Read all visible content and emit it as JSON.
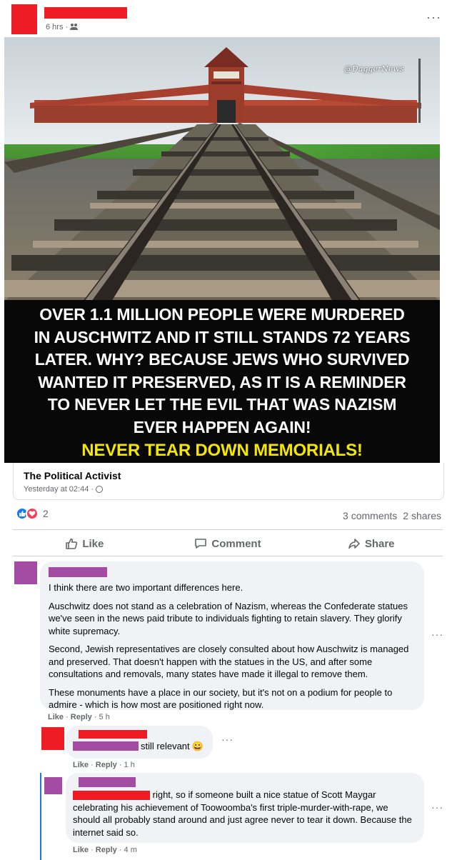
{
  "post": {
    "time": "6 hrs ·",
    "more": "···"
  },
  "image": {
    "watermark": "@DaggerNews",
    "caption_lines": [
      "OVER 1.1 MILLION PEOPLE WERE MURDERED",
      "IN AUSCHWITZ AND IT STILL STANDS 72 YEARS",
      "LATER. WHY? BECAUSE JEWS WHO SURVIVED",
      "WANTED IT PRESERVED, AS IT IS A REMINDER",
      "TO NEVER LET THE EVIL THAT WAS NAZISM",
      "EVER HAPPEN AGAIN!"
    ],
    "highlight": "NEVER TEAR DOWN MEMORIALS!"
  },
  "link": {
    "title": "The Political Activist",
    "time": "Yesterday at 02:44 ·"
  },
  "stats": {
    "reaction_count": "2",
    "comments": "3 comments",
    "shares": "2 shares"
  },
  "actions": {
    "like": "Like",
    "comment": "Comment",
    "share": "Share"
  },
  "comments": [
    {
      "paragraphs": [
        "I think there are two important differences here.",
        "Auschwitz does not stand as a celebration of Nazism, whereas the Confederate statues we've seen in the news paid tribute to individuals fighting to retain slavery. They glorify white supremacy.",
        "Second, Jewish representatives are closely consulted about how Auschwitz is managed and preserved. That doesn't happen with the statues in the US, and after some consultations and removals, many states have made it illegal to remove them.",
        "These monuments have a place in our society, but it's not on a podium for people to admire - which is how most are positioned right now."
      ],
      "like": "Like",
      "reply": "Reply",
      "time": "5 h"
    },
    {
      "text": "still relevant",
      "emoji": "😀",
      "like": "Like",
      "reply": "Reply",
      "time": "1 h"
    },
    {
      "text_first": "right, so if someone built a nice statue of Scott Maygar",
      "text_rest": "celebrating his achievement of Toowoomba's first triple-murder-with-rape, we should all probably stand around and just agree never to tear it down. Because the internet said so.",
      "like": "Like",
      "reply": "Reply",
      "time": "4 m"
    }
  ],
  "colors": {
    "redaction_red": "#ee1c25",
    "redaction_purple": "#a44ca4",
    "caption_yellow": "#f3e600",
    "like_blue": "#1877f2"
  }
}
